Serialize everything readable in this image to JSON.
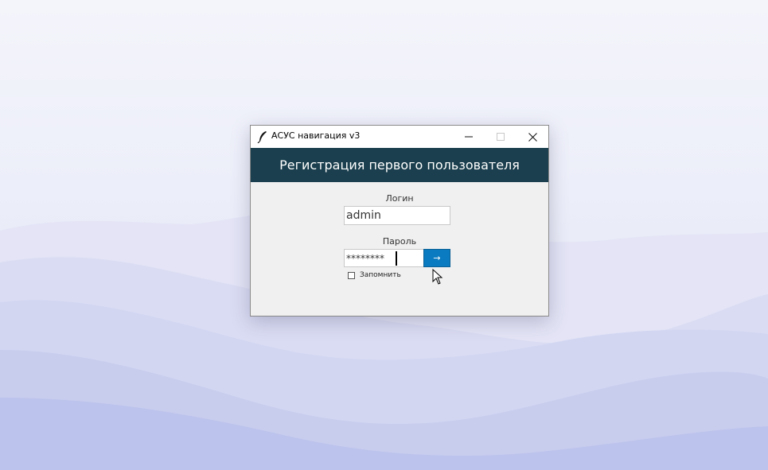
{
  "window": {
    "title": "АСУС навигация v3",
    "controls": {
      "minimize_icon": "minimize-icon",
      "maximize_icon": "maximize-icon",
      "close_icon": "close-icon"
    }
  },
  "header": {
    "title": "Регистрация первого пользователя",
    "background_color": "#1b3f4e"
  },
  "form": {
    "login_label": "Логин",
    "login_value": "admin",
    "password_label": "Пароль",
    "password_value": "********",
    "submit_icon": "arrow-right-icon",
    "submit_glyph": "→",
    "submit_color": "#0a7bc0",
    "remember_label": "Запомнить",
    "remember_checked": false
  }
}
